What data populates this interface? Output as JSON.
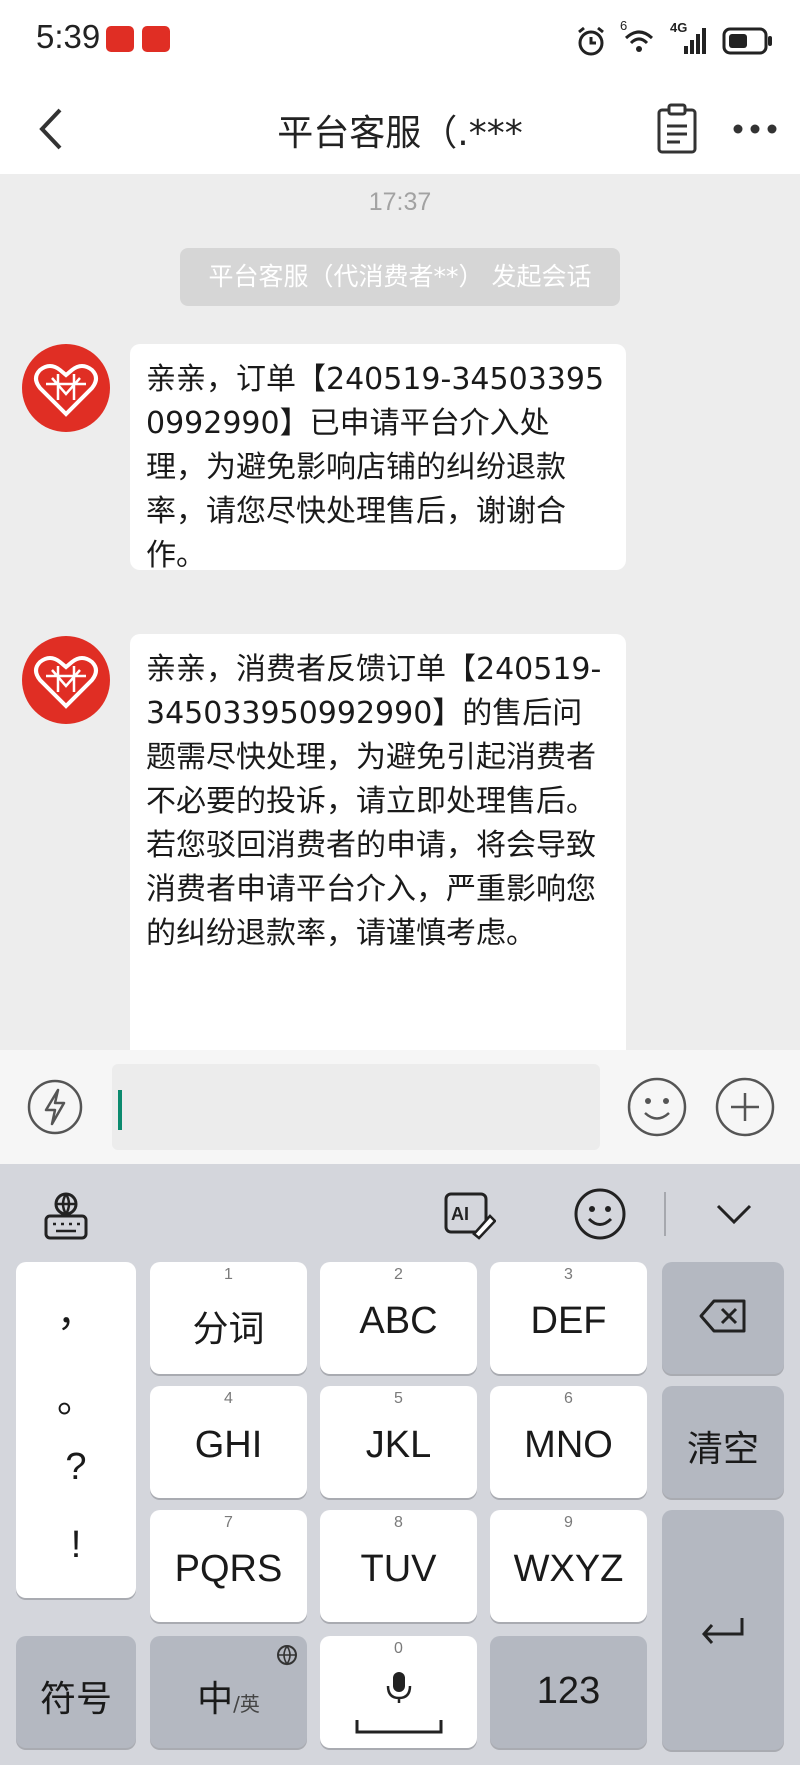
{
  "status_bar": {
    "time": "5:39",
    "app_icons": [
      "pinduoduo-icon",
      "pinduoduo-icon"
    ],
    "right_icons": [
      "alarm-icon",
      "wifi-icon",
      "signal-4g-icon",
      "battery-icon"
    ],
    "wifi_badge": "6",
    "network_label": "4G"
  },
  "header": {
    "title": "平台客服（.***",
    "back_icon": "back-chevron-icon",
    "order_icon": "clipboard-icon",
    "more_icon": "more-dots-icon"
  },
  "chat": {
    "timestamp": "17:37",
    "system_message": "平台客服（代消费者**） 发起会话",
    "messages": [
      {
        "sender_icon": "pinduoduo-heart-avatar",
        "text": "亲亲，订单【240519-345033950992990】已申请平台介入处理，为避免影响店铺的纠纷退款率，请您尽快处理售后，谢谢合作。"
      },
      {
        "sender_icon": "pinduoduo-heart-avatar",
        "text": "亲亲，消费者反馈订单【240519-345033950992990】的售后问题需尽快处理，为避免引起消费者不必要的投诉，请立即处理售后。若您驳回消费者的申请，将会导致消费者申请平台介入，严重影响您的纠纷退款率，请谨慎考虑。"
      }
    ]
  },
  "input_bar": {
    "quick_reply_icon": "lightning-icon",
    "value": "",
    "emoji_icon": "smile-icon",
    "add_icon": "plus-icon"
  },
  "keyboard": {
    "toolbar_icons": [
      "globe-keyboard-icon",
      "ai-write-icon",
      "emoji-icon",
      "collapse-chevron-icon"
    ],
    "punctuation": [
      "，",
      "。",
      "?",
      "!"
    ],
    "keys": [
      {
        "num": "1",
        "label": "分词"
      },
      {
        "num": "2",
        "label": "ABC"
      },
      {
        "num": "3",
        "label": "DEF"
      },
      {
        "num": "4",
        "label": "GHI"
      },
      {
        "num": "5",
        "label": "JKL"
      },
      {
        "num": "6",
        "label": "MNO"
      },
      {
        "num": "7",
        "label": "PQRS"
      },
      {
        "num": "8",
        "label": "TUV"
      },
      {
        "num": "9",
        "label": "WXYZ"
      }
    ],
    "clear_label": "清空",
    "symbols_label": "符号",
    "lang_main": "中",
    "lang_sub": "/英",
    "space_num": "0",
    "numbers_label": "123",
    "accent_color": "#e02e24"
  }
}
